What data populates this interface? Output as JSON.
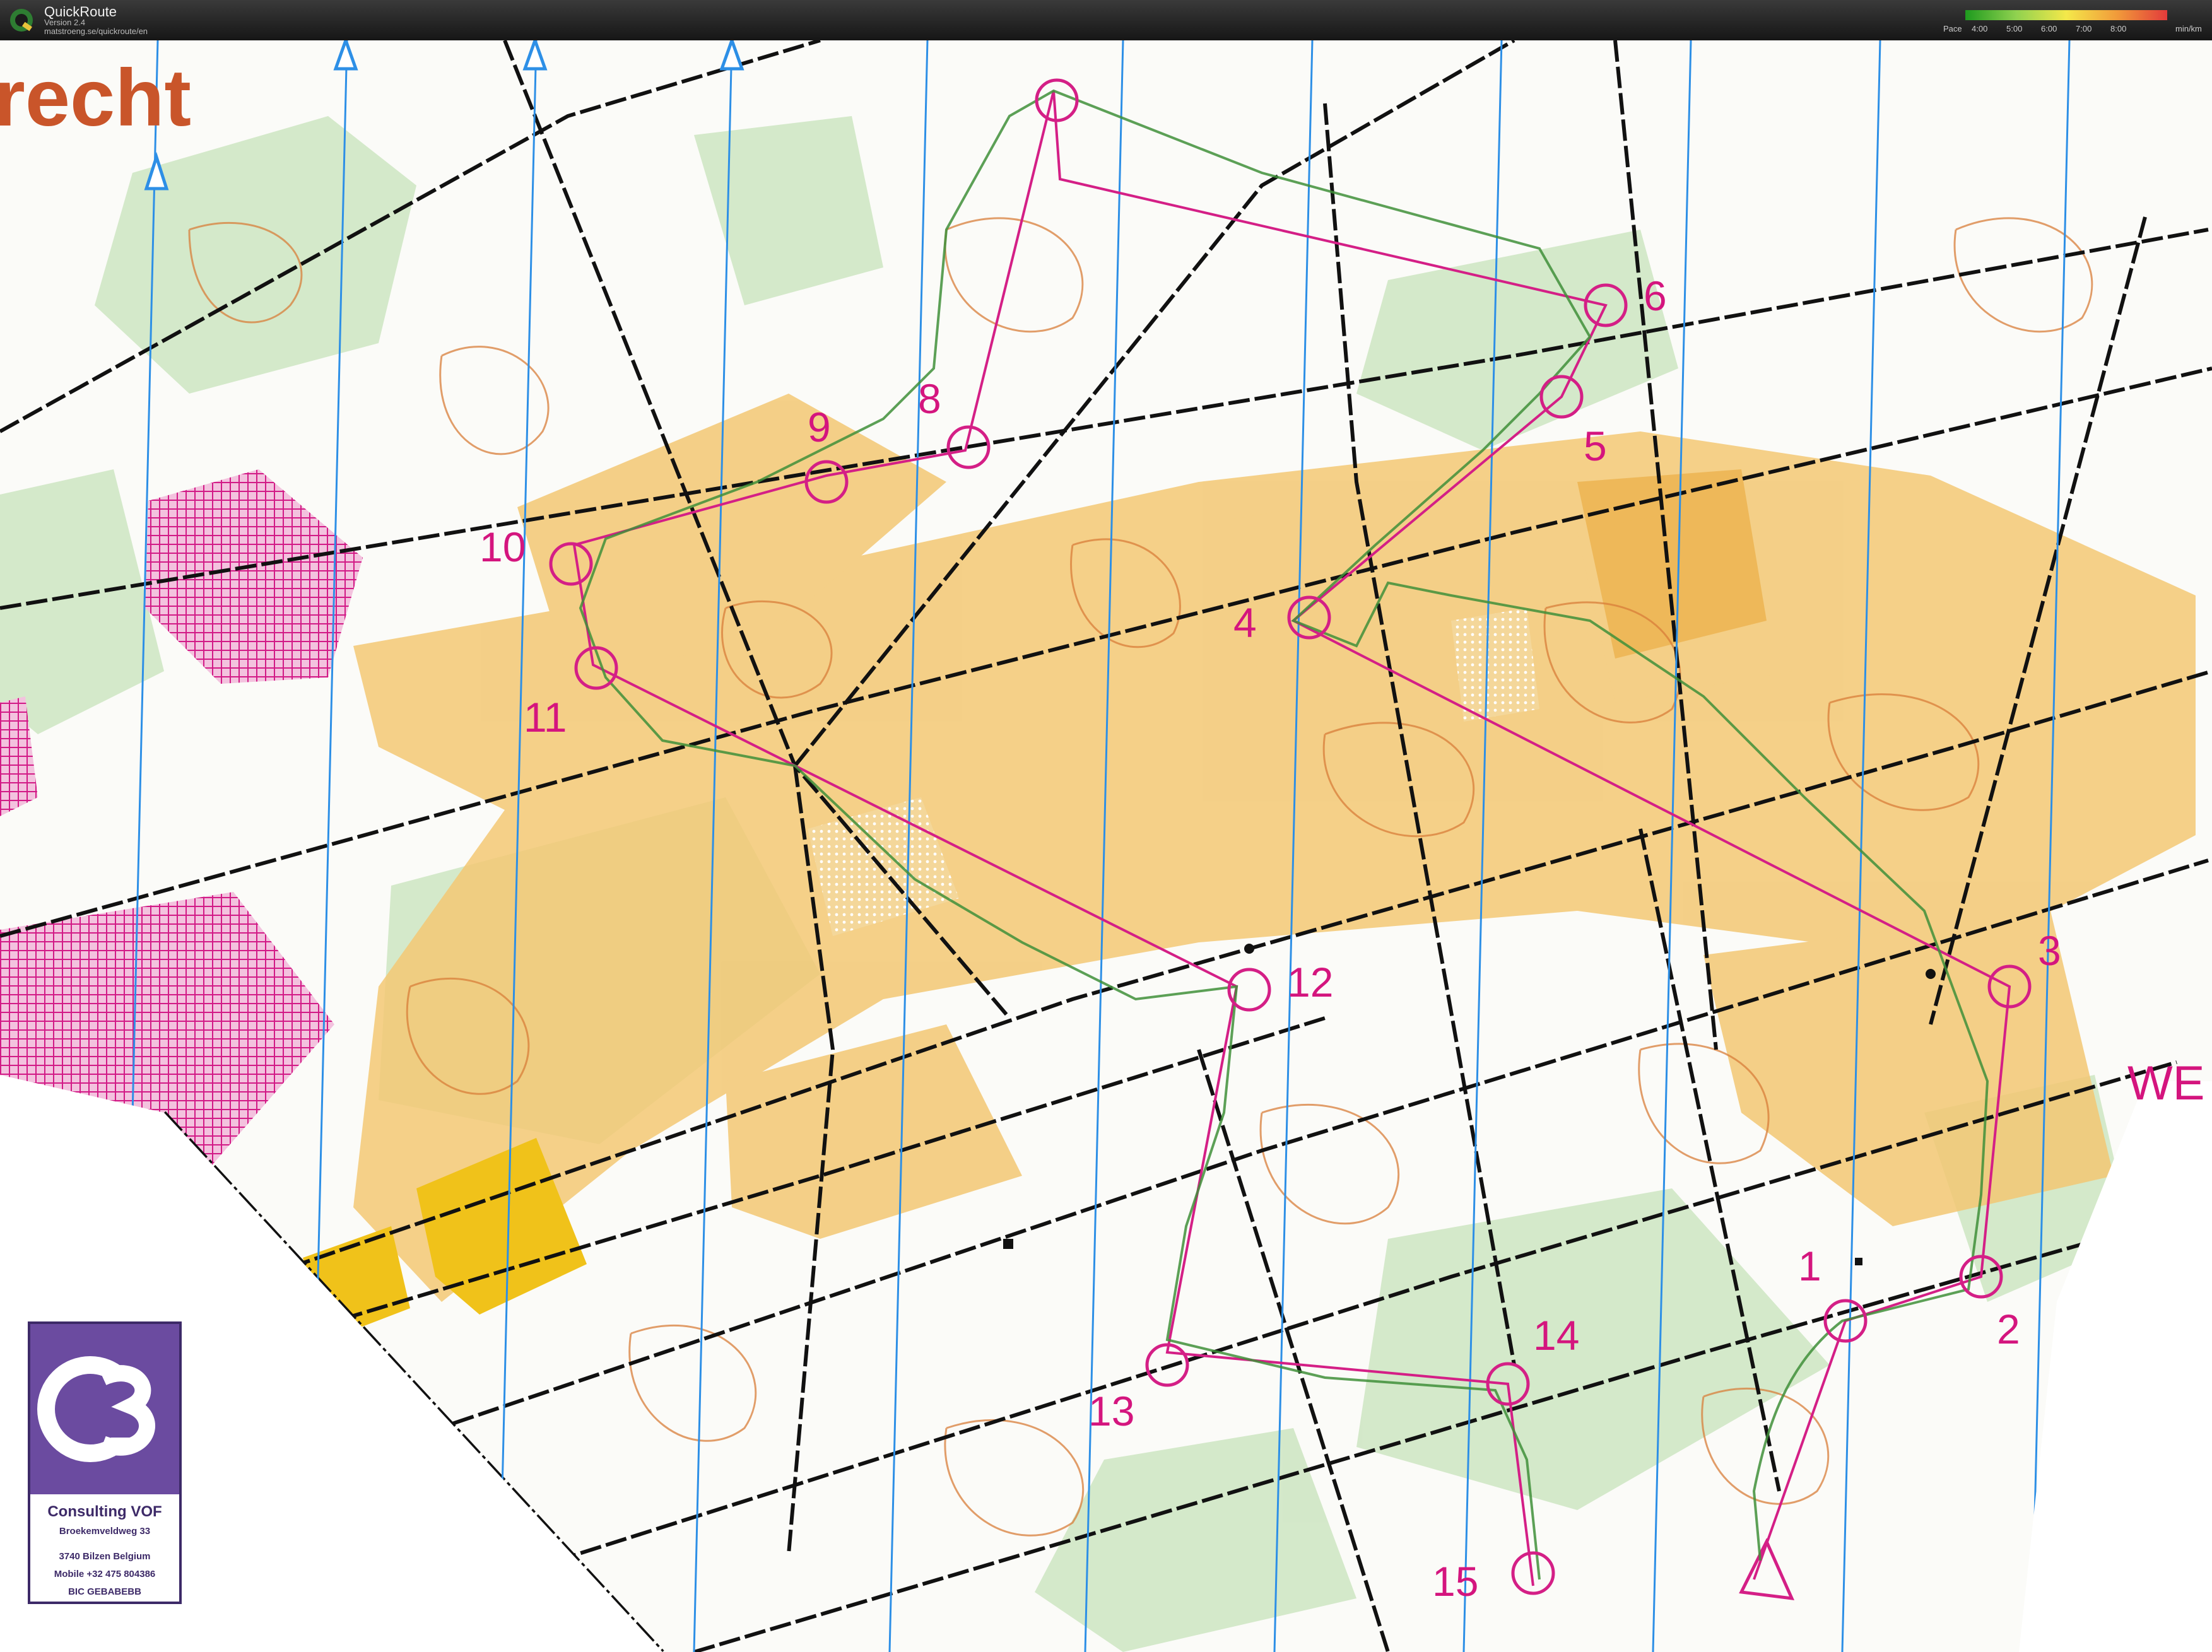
{
  "app": {
    "title": "QuickRoute",
    "version": "Version 2.4",
    "url": "matstroeng.se/quickroute/en"
  },
  "pace_legend": {
    "label": "Pace",
    "ticks": [
      "4:00",
      "5:00",
      "6:00",
      "7:00",
      "8:00"
    ],
    "unit": "min/km"
  },
  "map": {
    "title_fragment": "recht",
    "edge_label": "WE",
    "controls": [
      "1",
      "2",
      "3",
      "4",
      "5",
      "6",
      "8",
      "9",
      "10",
      "11",
      "12",
      "13",
      "14",
      "15"
    ]
  },
  "sponsor": {
    "name": "Consulting VOF",
    "street": "Broekemveldweg 33",
    "city": "3740 Bilzen Belgium",
    "phone": "Mobile +32 475 804386",
    "bic": "BIC GEBABEBB"
  }
}
